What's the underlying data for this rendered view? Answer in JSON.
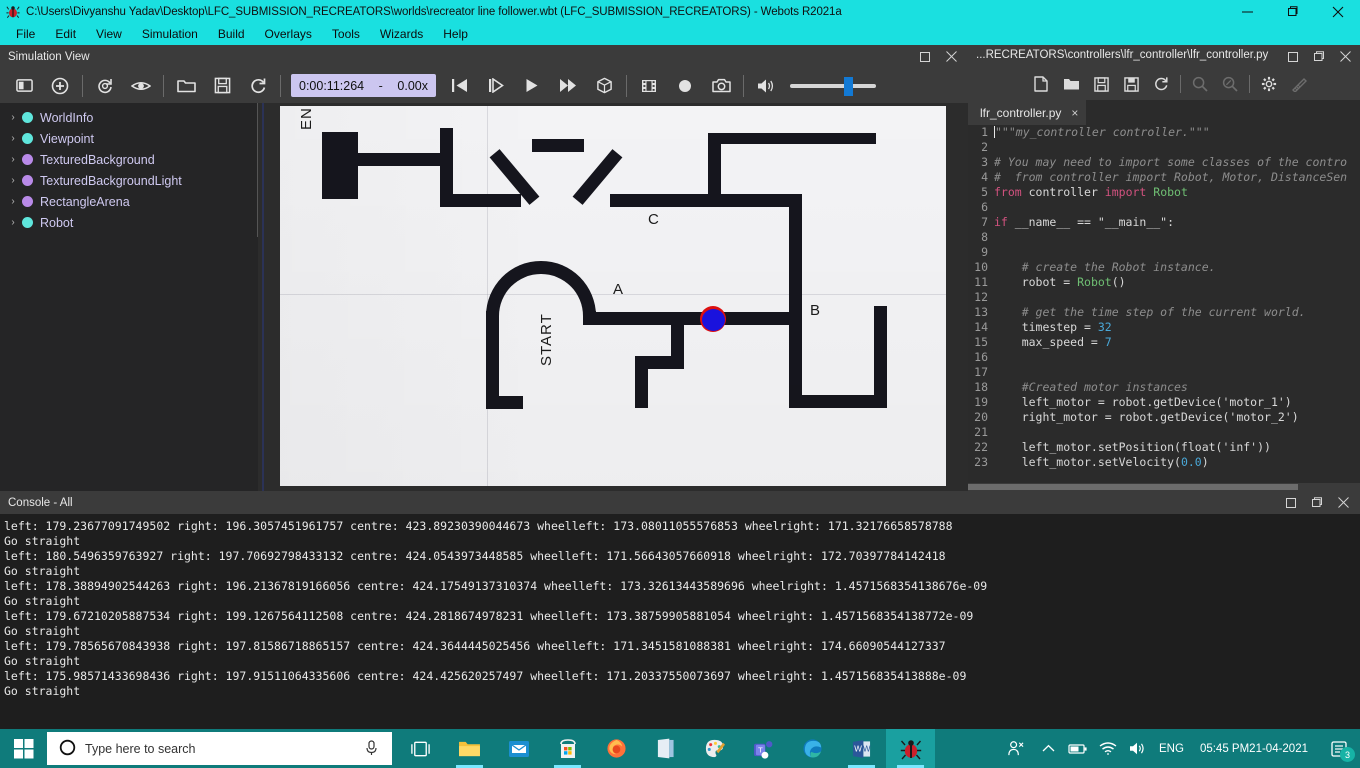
{
  "window": {
    "title": "C:\\Users\\Divyanshu Yadav\\Desktop\\LFC_SUBMISSION_RECREATORS\\worlds\\recreator line follower.wbt (LFC_SUBMISSION_RECREATORS) - Webots R2021a",
    "app_icon": "webots-bug-icon",
    "minimize": "minimize-icon",
    "maximize": "maximize-icon",
    "close": "close-icon"
  },
  "menubar": {
    "items": [
      "File",
      "Edit",
      "View",
      "Simulation",
      "Build",
      "Overlays",
      "Tools",
      "Wizards",
      "Help"
    ]
  },
  "simulation_panel": {
    "title": "Simulation View",
    "restore_label": "restore-icon",
    "close_label": "close-icon",
    "time": "0:00:11:264",
    "separator": "-",
    "speed": "0.00x",
    "toolbar_icons": [
      "toggle-sidebar-icon",
      "add-node-icon",
      "reload-world-icon",
      "view-eye-icon",
      "open-world-icon",
      "save-world-icon",
      "reset-simulation-icon",
      "rewind-icon",
      "step-icon",
      "play-icon",
      "fast-forward-icon",
      "3d-view-icon",
      "movie-icon",
      "record-icon",
      "screenshot-icon",
      "sound-icon"
    ],
    "volume_value": 62
  },
  "scene_tree": {
    "items": [
      {
        "label": "WorldInfo",
        "color": "#5fe6dc"
      },
      {
        "label": "Viewpoint",
        "color": "#5fe6dc"
      },
      {
        "label": "TexturedBackground",
        "color": "#b98ae8"
      },
      {
        "label": "TexturedBackgroundLight",
        "color": "#b98ae8"
      },
      {
        "label": "RectangleArena",
        "color": "#b98ae8"
      },
      {
        "label": "Robot",
        "color": "#5fe6dc"
      }
    ],
    "expand_arrow": "›"
  },
  "scene_labels": {
    "end": "END",
    "start": "START",
    "a": "A",
    "b": "B",
    "c": "C"
  },
  "editor_panel": {
    "title": "...RECREATORS\\controllers\\lfr_controller\\lfr_controller.py",
    "restore_label": "restore-icon",
    "maximize_label": "maximize-icon",
    "close_label": "close-icon",
    "toolbar_icons": [
      "new-file-icon",
      "open-file-icon",
      "save-file-icon",
      "save-all-icon",
      "reload-file-icon",
      "find-icon",
      "find-replace-icon",
      "settings-gear-icon",
      "clean-icon"
    ],
    "tab": {
      "label": "lfr_controller.py",
      "close": "×"
    },
    "code_lines": [
      {
        "n": 1,
        "text": "\"\"\"my_controller controller.\"\"\"",
        "kind": "comment",
        "caret": true
      },
      {
        "n": 2,
        "text": "",
        "kind": "plain"
      },
      {
        "n": 3,
        "text": "# You may need to import some classes of the contro",
        "kind": "comment"
      },
      {
        "n": 4,
        "text": "#  from controller import Robot, Motor, DistanceSen",
        "kind": "comment"
      },
      {
        "n": 5,
        "text": "from controller import Robot",
        "kind": "import"
      },
      {
        "n": 6,
        "text": "",
        "kind": "plain"
      },
      {
        "n": 7,
        "text": "if __name__ == \"__main__\":",
        "kind": "ifmain"
      },
      {
        "n": 8,
        "text": "",
        "kind": "plain"
      },
      {
        "n": 9,
        "text": "",
        "kind": "plain"
      },
      {
        "n": 10,
        "text": "    # create the Robot instance.",
        "kind": "comment"
      },
      {
        "n": 11,
        "text": "    robot = Robot()",
        "kind": "robotcall"
      },
      {
        "n": 12,
        "text": "",
        "kind": "plain"
      },
      {
        "n": 13,
        "text": "    # get the time step of the current world.",
        "kind": "comment"
      },
      {
        "n": 14,
        "text": "    timestep = 32",
        "kind": "assign_num"
      },
      {
        "n": 15,
        "text": "    max_speed = 7",
        "kind": "assign_num"
      },
      {
        "n": 16,
        "text": "",
        "kind": "plain"
      },
      {
        "n": 17,
        "text": "",
        "kind": "plain"
      },
      {
        "n": 18,
        "text": "    #Created motor instances",
        "kind": "comment"
      },
      {
        "n": 19,
        "text": "    left_motor = robot.getDevice('motor_1')",
        "kind": "plain"
      },
      {
        "n": 20,
        "text": "    right_motor = robot.getDevice('motor_2')",
        "kind": "plain"
      },
      {
        "n": 21,
        "text": "",
        "kind": "plain"
      },
      {
        "n": 22,
        "text": "    left_motor.setPosition(float('inf'))",
        "kind": "plain"
      },
      {
        "n": 23,
        "text": "    left_motor.setVelocity(0.0)",
        "kind": "plain"
      }
    ]
  },
  "console": {
    "title": "Console - All",
    "restore_label": "restore-icon",
    "maximize_label": "maximize-icon",
    "close_label": "close-icon",
    "lines": [
      "left: 179.23677091749502 right: 196.3057451961757 centre: 423.89230390044673 wheelleft: 173.08011055576853 wheelright: 171.32176658578788",
      "Go straight",
      "left: 180.5496359763927 right: 197.70692798433132 centre: 424.0543973448585 wheelleft: 171.56643057660918 wheelright: 172.70397784142418",
      "Go straight",
      "left: 178.38894902544263 right: 196.21367819166056 centre: 424.17549137310374 wheelleft: 173.32613443589696 wheelright: 1.4571568354138676e-09",
      "Go straight",
      "left: 179.67210205887534 right: 199.1267564112508 centre: 424.2818674978231 wheelleft: 173.38759905881054 wheelright: 1.4571568354138772e-09",
      "Go straight",
      "left: 179.78565670843938 right: 197.81586718865157 centre: 424.3644445025456 wheelleft: 171.3451581088381 wheelright: 174.66090544127337",
      "Go straight",
      "left: 175.98571433698436 right: 197.91511064335606 centre: 424.425620257497 wheelleft: 171.20337550073697 wheelright: 1.457156835413888e-09",
      "Go straight"
    ]
  },
  "taskbar": {
    "start": "windows-start-icon",
    "search_placeholder": "Type here to search",
    "search_icon": "search-circle-icon",
    "mic_icon": "microphone-icon",
    "apps": [
      {
        "name": "task-view-icon"
      },
      {
        "name": "file-explorer-icon"
      },
      {
        "name": "mail-icon"
      },
      {
        "name": "microsoft-store-icon"
      },
      {
        "name": "firefox-icon"
      },
      {
        "name": "onenote-icon"
      },
      {
        "name": "paint-icon"
      },
      {
        "name": "microsoft-teams-icon"
      },
      {
        "name": "microsoft-edge-icon"
      },
      {
        "name": "word-icon"
      },
      {
        "name": "webots-icon"
      }
    ],
    "tray": {
      "people_icon": "people-icon",
      "chevron_icon": "show-hidden-icons-icon",
      "battery_icon": "battery-icon",
      "wifi_icon": "wifi-icon",
      "volume_icon": "volume-icon",
      "language": "ENG",
      "time": "05:45 PM",
      "date": "21-04-2021",
      "notification_icon": "notifications-icon",
      "notification_count": "3"
    }
  },
  "colors": {
    "title_bar": "#1ae0e0",
    "panel_bg": "#3b3b3b",
    "console_bg": "#1e1e1e",
    "taskbar": "#0f7b7b",
    "accent_blue": "#1279d4"
  }
}
